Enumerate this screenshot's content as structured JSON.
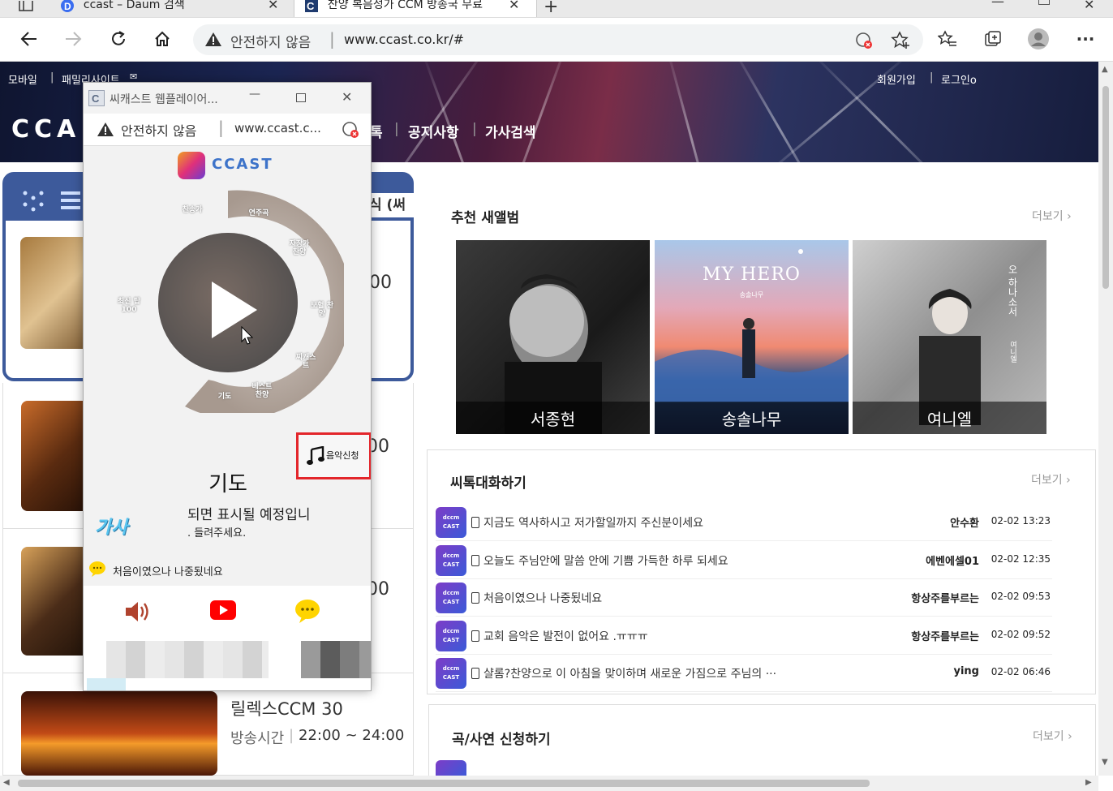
{
  "browser": {
    "tabs": [
      {
        "title": "ccast – Daum 검색"
      },
      {
        "title": "찬양 복음성가 CCM 방송국 무료"
      }
    ],
    "address": {
      "security": "안전하지 않음",
      "url": "www.ccast.co.kr/#"
    }
  },
  "site": {
    "top_links_left": [
      "모바일",
      "패밀리사이트"
    ],
    "top_links_right": [
      "회원가입",
      "로그인o"
    ],
    "logo": "CCA",
    "menu": [
      "톡",
      "공지사항",
      "가사검색"
    ],
    "left_fragments": [
      "식 (써",
      "00",
      "00",
      "00"
    ],
    "program": {
      "name": "릴렉스CCM 30",
      "time_label": "방송시간",
      "time": "22:00 ~ 24:00"
    },
    "albums_section": {
      "title": "추천 새앨범",
      "more": "더보기",
      "albums": [
        {
          "artist": "서종현"
        },
        {
          "artist": "송솔나무",
          "cover_text": "MY HERO",
          "cover_sub": "송솔나무"
        },
        {
          "artist": "여니엘",
          "cover_text": "오 하나소서",
          "cover_sub": "여니엘"
        }
      ]
    },
    "talk_section": {
      "title": "씨톡대화하기",
      "more": "더보기",
      "rows": [
        {
          "msg": "지금도 역사하시고 저가할일까지 주신분이세요",
          "user": "안수환",
          "time": "02-02 13:23"
        },
        {
          "msg": "오늘도 주님안에 말씀 안에 기쁨 가득한 하루 되세요",
          "user": "에벤에셀01",
          "time": "02-02 12:35"
        },
        {
          "msg": "처음이였으나 나중됬네요",
          "user": "항상주를부르는",
          "time": "02-02 09:53"
        },
        {
          "msg": "교회 음악은 발전이 없어요 .ㅠㅠㅠ",
          "user": "항상주를부르는",
          "time": "02-02 09:52"
        },
        {
          "msg": "샬롬?찬양으로 이 아침을 맞이하며 새로운 가짐으로 주님의 ···",
          "user": "ying",
          "time": "02-02 06:46"
        }
      ]
    },
    "request_section": {
      "title": "곡/사연 신청하기",
      "more": "더보기"
    }
  },
  "popup": {
    "window_title": "씨캐스트 웹플레이어...",
    "security": "안전하지 않음",
    "url": "www.ccast.c...",
    "brand": "CCAST",
    "channels": [
      "찬송가",
      "연주곡",
      "자장가 찬양",
      "보혈 찬양",
      "최신 탑100",
      "찌캐스트",
      "베스트 찬양",
      "기도"
    ],
    "request_button": "음악신청",
    "song_title": "기도",
    "lyrics_label": "가사",
    "lyrics_line1": "되면 표시될 예정입니",
    "lyrics_line2": ". 들려주세요.",
    "chat_message": "처음이였으나 나중됬네요"
  },
  "colors": {
    "highlight": "#e3262b",
    "panel_blue": "#3d5a9b",
    "youtube": "#ff0000",
    "chat": "#ffd400"
  }
}
